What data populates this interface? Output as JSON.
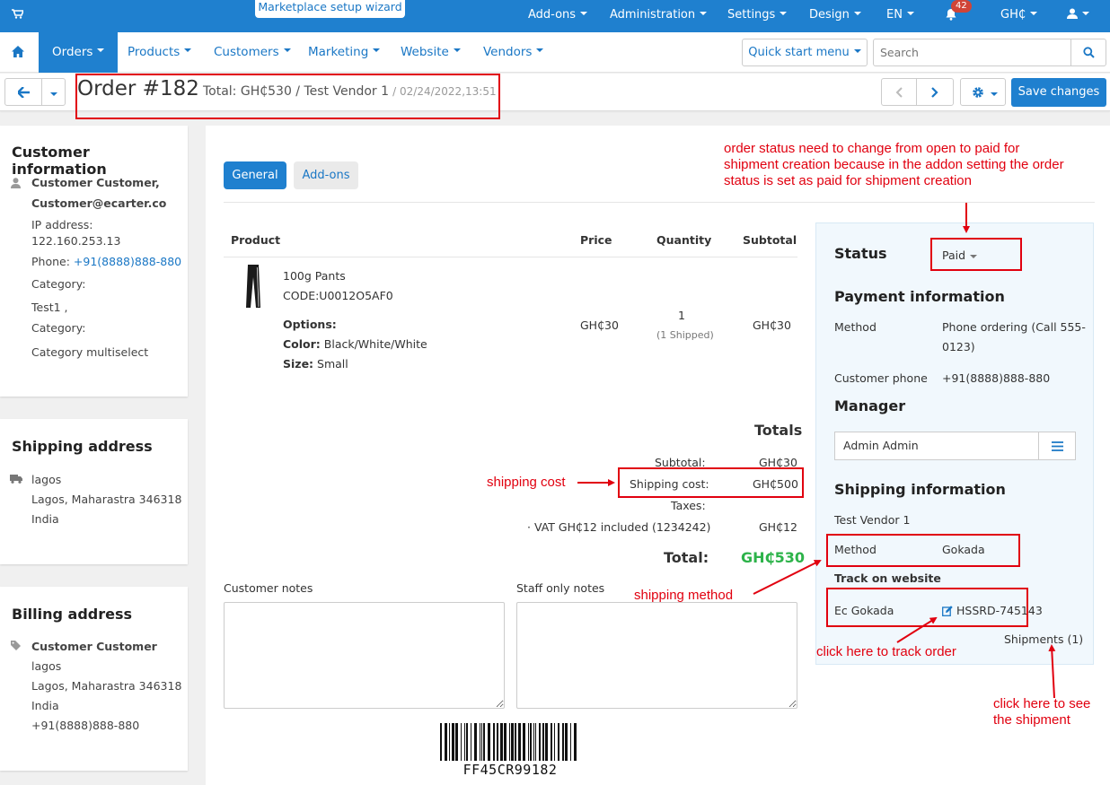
{
  "topbar": {
    "wizard": "Marketplace setup wizard",
    "items": [
      "Add-ons",
      "Administration",
      "Settings",
      "Design",
      "EN",
      "GH₵"
    ],
    "notifications_count": "42"
  },
  "nav": {
    "items": [
      "Orders",
      "Products",
      "Customers",
      "Marketing",
      "Website",
      "Vendors"
    ],
    "quick_start": "Quick start menu",
    "search_placeholder": "Search"
  },
  "order": {
    "title": "Order #182",
    "summary": "Total: GH₵530 / Test Vendor 1",
    "date": "/ 02/24/2022,13:51",
    "save_label": "Save changes"
  },
  "customer": {
    "heading": "Customer information",
    "name": "Customer Customer,",
    "email": "Customer@ecarter.co",
    "ip_label": "IP address:",
    "ip": "122.160.253.13",
    "phone_label": "Phone:",
    "phone": "+91(8888)888-880",
    "category_label": "Category:",
    "category_value": "Test1 ,",
    "category2_label": "Category:",
    "category2_value": "Category multiselect"
  },
  "shipping_address": {
    "heading": "Shipping address",
    "line1": "lagos",
    "line2": "Lagos, Maharastra 346318",
    "line3": "India"
  },
  "billing_address": {
    "heading": "Billing address",
    "name": "Customer Customer",
    "line1": "lagos",
    "line2": "Lagos, Maharastra 346318",
    "line3": "India",
    "phone": "+91(8888)888-880"
  },
  "tabs": [
    "General",
    "Add-ons"
  ],
  "products": {
    "columns": [
      "Product",
      "Price",
      "Quantity",
      "Subtotal"
    ],
    "rows": [
      {
        "name": "100g Pants",
        "code": "CODE:U0012O5AF0",
        "options_label": "Options:",
        "color_label": "Color:",
        "color": "Black/White/White",
        "size_label": "Size:",
        "size": "Small",
        "price": "GH₵30",
        "qty": "1",
        "shipped": "(1 Shipped)",
        "subtotal": "GH₵30"
      }
    ]
  },
  "totals": {
    "heading": "Totals",
    "subtotal_label": "Subtotal:",
    "subtotal": "GH₵30",
    "shipping_label": "Shipping cost:",
    "shipping": "GH₵500",
    "taxes_label": "Taxes:",
    "vat_label": "· VAT  GH₵12  included (1234242)",
    "vat": "GH₵12",
    "total_label": "Total:",
    "total": "GH₵530"
  },
  "notes": {
    "customer_label": "Customer notes",
    "staff_label": "Staff only notes"
  },
  "barcode": "FF45CR99182",
  "side": {
    "status_heading": "Status",
    "status_value": "Paid",
    "payment_heading": "Payment information",
    "method_label": "Method",
    "method_value_1": "Phone ordering (Call 555-",
    "method_value_2": "0123)",
    "phone_label": "Customer phone",
    "phone_value": "+91(8888)888-880",
    "manager_heading": "Manager",
    "manager_value": "Admin Admin",
    "shipping_heading": "Shipping information",
    "vendor": "Test Vendor 1",
    "ship_method_label": "Method",
    "ship_method_value": "Gokada",
    "track_heading": "Track on website",
    "carrier": "Ec Gokada",
    "tracking": "HSSRD-745143",
    "shipments": "Shipments (1)"
  },
  "annotations": {
    "status_note_1": "order status need to change from open to paid for",
    "status_note_2": "shipment creation because in the addon setting the order",
    "status_note_3": "status is set as paid for shipment creation",
    "shipping_cost": "shipping cost",
    "shipping_method": "shipping method",
    "track_order": "click here to track order",
    "see_shipment_1": "click here to see",
    "see_shipment_2": "the shipment",
    "color": "#e1000f"
  },
  "colors": {
    "primary": "#1f80cf",
    "link": "#1a77c5",
    "total": "#2db34a",
    "badge": "#d04437"
  }
}
